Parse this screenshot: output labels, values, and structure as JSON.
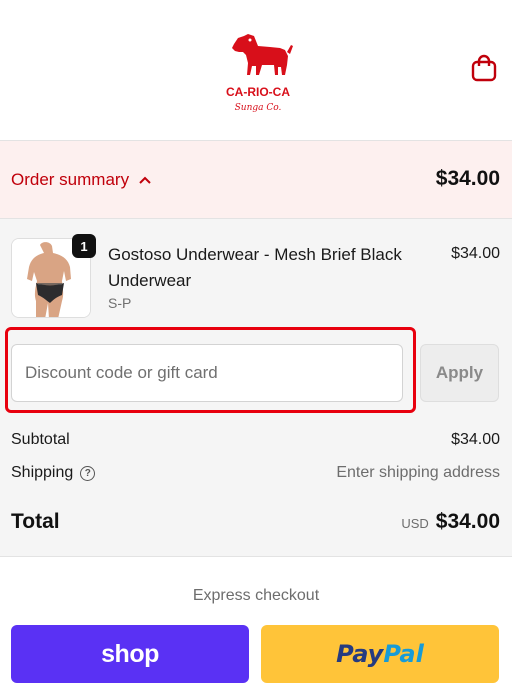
{
  "header": {
    "logo_text": "CA-RIO-CA",
    "logo_sub": "Sunga Co.",
    "cart_icon": "shopping-bag-icon"
  },
  "order_summary": {
    "label": "Order summary",
    "toggle_icon": "chevron-up-icon",
    "total": "$34.00"
  },
  "line_item": {
    "name": "Gostoso Underwear - Mesh Brief Black Underwear",
    "variant": "S-P",
    "price": "$34.00",
    "quantity": "1"
  },
  "discount": {
    "placeholder": "Discount code or gift card",
    "value": "",
    "apply_label": "Apply"
  },
  "totals": {
    "subtotal_label": "Subtotal",
    "subtotal_value": "$34.00",
    "shipping_label": "Shipping",
    "shipping_value": "Enter shipping address",
    "total_label": "Total",
    "currency": "USD",
    "total_value": "$34.00"
  },
  "express": {
    "label": "Express checkout",
    "shop_label": "shop",
    "paypal_part1": "Pay",
    "paypal_part2": "Pal"
  },
  "colors": {
    "brand_red": "#c0000b",
    "highlight": "#e8000e",
    "shop_purple": "#5a31f4",
    "paypal_yellow": "#ffc439"
  }
}
